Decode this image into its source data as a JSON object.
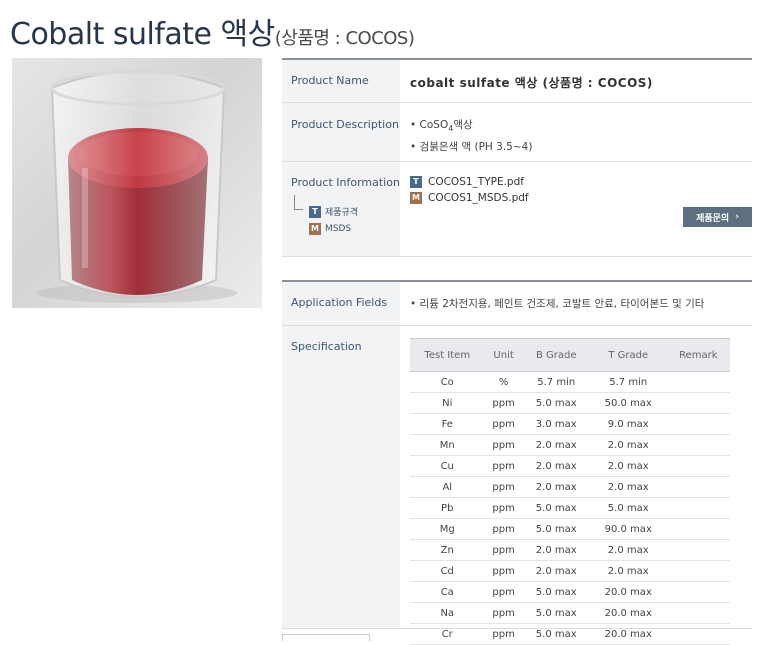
{
  "header": {
    "title": "Cobalt sulfate 액상",
    "subtitle": "(상품명 : COCOS)"
  },
  "product": {
    "name_label": "Product Name",
    "name_value": "cobalt sulfate 액상 (상품명 : COCOS)",
    "desc_label": "Product Description",
    "desc_line1_pre": "• CoSO",
    "desc_line1_sub": "4",
    "desc_line1_post": "액상",
    "desc_line2": "• 검붉은색 액 (PH 3.5~4)",
    "info_label": "Product Information",
    "info_links": [
      {
        "badge": "T",
        "label": "제품규격"
      },
      {
        "badge": "M",
        "label": "MSDS"
      }
    ],
    "files": [
      {
        "badge": "T",
        "name": "COCOS1_TYPE.pdf"
      },
      {
        "badge": "M",
        "name": "COCOS1_MSDS.pdf"
      }
    ],
    "inquiry_button": "제품문의",
    "inquiry_arrow": "›"
  },
  "application": {
    "label": "Application Fields",
    "value": "• 리튬 2차전지용, 페인트 건조제, 코발트 안료, 타이어본드 및 기타"
  },
  "specification": {
    "label": "Specification",
    "headers": [
      "Test Item",
      "Unit",
      "B Grade",
      "T Grade",
      "Remark"
    ],
    "rows": [
      [
        "Co",
        "%",
        "5.7 min",
        "5.7 min",
        ""
      ],
      [
        "Ni",
        "ppm",
        "5.0 max",
        "50.0 max",
        ""
      ],
      [
        "Fe",
        "ppm",
        "3.0 max",
        "9.0 max",
        ""
      ],
      [
        "Mn",
        "ppm",
        "2.0 max",
        "2.0 max",
        ""
      ],
      [
        "Cu",
        "ppm",
        "2.0 max",
        "2.0 max",
        ""
      ],
      [
        "Al",
        "ppm",
        "2.0 max",
        "2.0 max",
        ""
      ],
      [
        "Pb",
        "ppm",
        "5.0 max",
        "5.0 max",
        ""
      ],
      [
        "Mg",
        "ppm",
        "5.0 max",
        "90.0 max",
        ""
      ],
      [
        "Zn",
        "ppm",
        "2.0 max",
        "2.0 max",
        ""
      ],
      [
        "Cd",
        "ppm",
        "2.0 max",
        "2.0 max",
        ""
      ],
      [
        "Ca",
        "ppm",
        "5.0 max",
        "20.0 max",
        ""
      ],
      [
        "Na",
        "ppm",
        "5.0 max",
        "20.0 max",
        ""
      ],
      [
        "Cr",
        "ppm",
        "5.0 max",
        "20.0 max",
        ""
      ]
    ]
  },
  "colors": {
    "title": "#27364a",
    "label_text": "#3f5570",
    "label_bg": "#f2f3f5",
    "badge_t": "#4b6a8a",
    "badge_m": "#a07150",
    "button_bg": "#5d6f80"
  },
  "image": {
    "icon": "beaker-red-liquid-icon"
  }
}
